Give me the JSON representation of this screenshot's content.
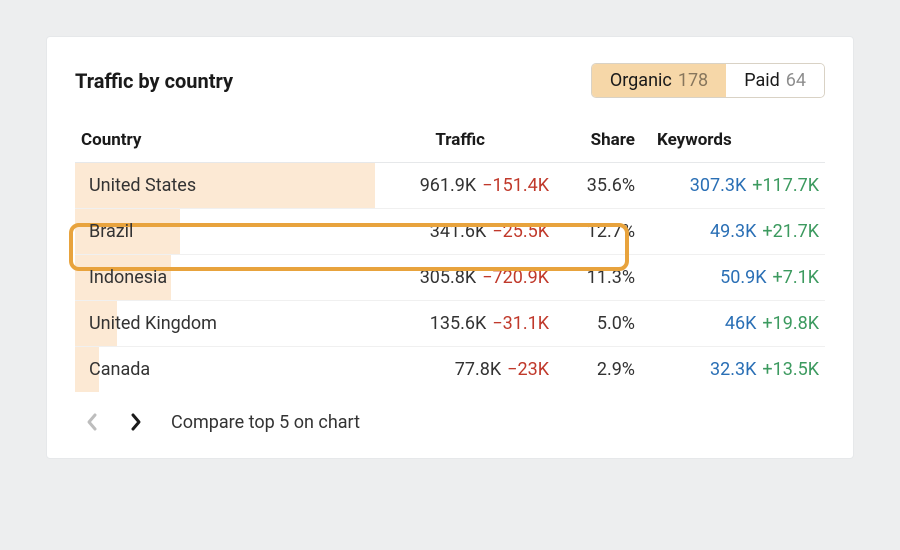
{
  "panel": {
    "title": "Traffic by country",
    "toggle": {
      "organic": {
        "label": "Organic",
        "count": "178"
      },
      "paid": {
        "label": "Paid",
        "count": "64"
      }
    },
    "columns": {
      "country": "Country",
      "traffic": "Traffic",
      "share": "Share",
      "keywords": "Keywords"
    },
    "rows": [
      {
        "country": "United States",
        "barPct": "100",
        "traffic": "961.9K",
        "trafficDelta": "−151.4K",
        "share": "35.6%",
        "keywords": "307.3K",
        "keywordsDelta": "+117.7K"
      },
      {
        "country": "Brazil",
        "barPct": "35",
        "traffic": "341.6K",
        "trafficDelta": "−25.5K",
        "share": "12.7%",
        "keywords": "49.3K",
        "keywordsDelta": "+21.7K"
      },
      {
        "country": "Indonesia",
        "barPct": "32",
        "traffic": "305.8K",
        "trafficDelta": "−720.9K",
        "share": "11.3%",
        "keywords": "50.9K",
        "keywordsDelta": "+7.1K"
      },
      {
        "country": "United Kingdom",
        "barPct": "14",
        "traffic": "135.6K",
        "trafficDelta": "−31.1K",
        "share": "5.0%",
        "keywords": "46K",
        "keywordsDelta": "+19.8K"
      },
      {
        "country": "Canada",
        "barPct": "8",
        "traffic": "77.8K",
        "trafficDelta": "−23K",
        "share": "2.9%",
        "keywords": "32.3K",
        "keywordsDelta": "+13.5K"
      }
    ],
    "compare": "Compare top 5 on chart"
  }
}
